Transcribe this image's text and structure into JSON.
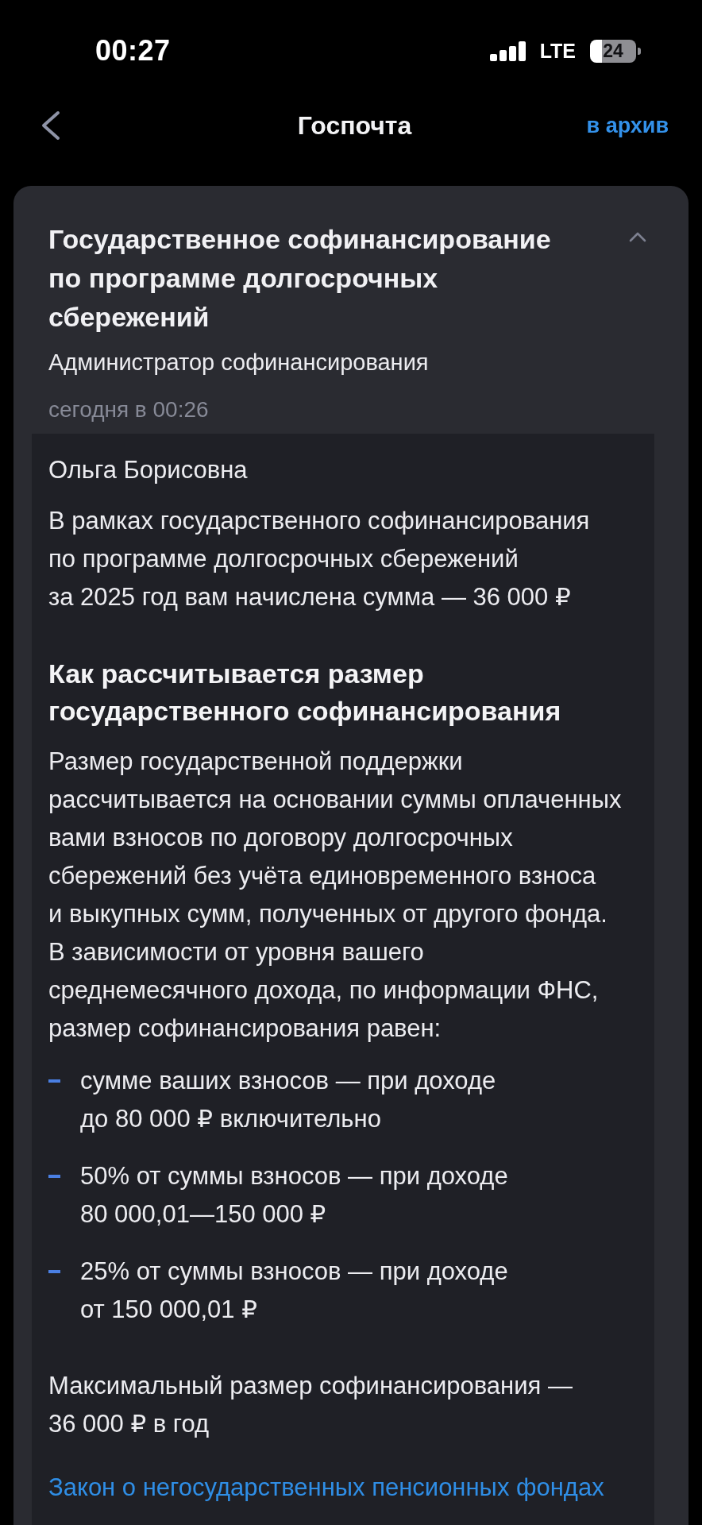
{
  "status_bar": {
    "time": "00:27",
    "network": "LTE",
    "battery": "24"
  },
  "nav_bar": {
    "title": "Госпочта",
    "action": "в архив"
  },
  "message": {
    "title": "Государственное софинансирование\nпо программе долгосрочных\nсбережений",
    "sender": "Администратор софинансирования",
    "date": "сегодня в 00:26",
    "expanded": true,
    "blocks": [
      {
        "kind": "greeting",
        "text": "Ольга Борисовна"
      },
      {
        "kind": "paragraph",
        "text": "В рамках государственного софинансирования\nпо программе долгосрочных сбережений\nза 2025 год вам начислена сумма — 36 000 ₽"
      },
      {
        "kind": "heading",
        "text": "Как рассчитывается размер\nгосударственного софинансирования"
      },
      {
        "kind": "paragraph",
        "text": "Размер государственной поддержки\nрассчитывается на основании суммы оплаченных\nвами взносов по договору долгосрочных\nсбережений без учёта единовременного взноса\nи выкупных сумм, полученных от другого фонда.\nВ зависимости от уровня вашего\nсреднемесячного дохода, по информации ФНС,\nразмер софинансирования равен:"
      },
      {
        "kind": "list",
        "items": [
          "сумме ваших взносов — при доходе\nдо 80 000 ₽ включительно",
          "50% от суммы взносов — при доходе\n80 000,01—150 000 ₽",
          "25% от суммы взносов — при доходе\nот 150 000,01 ₽"
        ]
      },
      {
        "kind": "paragraph",
        "text": "Максимальный размер софинансирования —\n36 000 ₽ в год"
      },
      {
        "kind": "link",
        "text": "Закон о негосударственных пенсионных фондах"
      }
    ]
  }
}
